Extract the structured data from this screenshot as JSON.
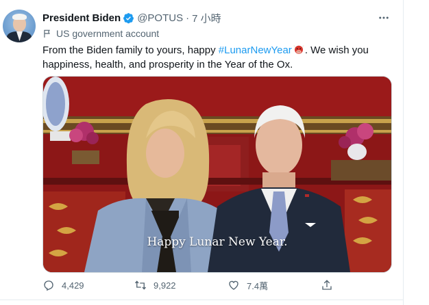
{
  "tweet": {
    "display_name": "President Biden",
    "handle": "@POTUS",
    "separator": "·",
    "time": "7 小時",
    "account_label": "US government account",
    "text_before": "From the Biden family to yours, happy ",
    "hashtag": "#LunarNewYear",
    "text_after": ". We wish you happiness, health, and prosperity in the Year of the Ox.",
    "video_caption": "Happy Lunar New Year."
  },
  "actions": {
    "replies": "4,429",
    "retweets": "9,922",
    "likes": "7.4萬"
  },
  "icons": {
    "verified": "verified-badge-icon",
    "more": "more-options-icon",
    "label": "flag-icon",
    "emoji": "ox-emoji-icon",
    "reply": "reply-icon",
    "retweet": "retweet-icon",
    "like": "heart-icon",
    "share": "share-icon"
  },
  "colors": {
    "accent": "#1d9bf0",
    "text": "#0f1419",
    "secondary": "#536471"
  }
}
